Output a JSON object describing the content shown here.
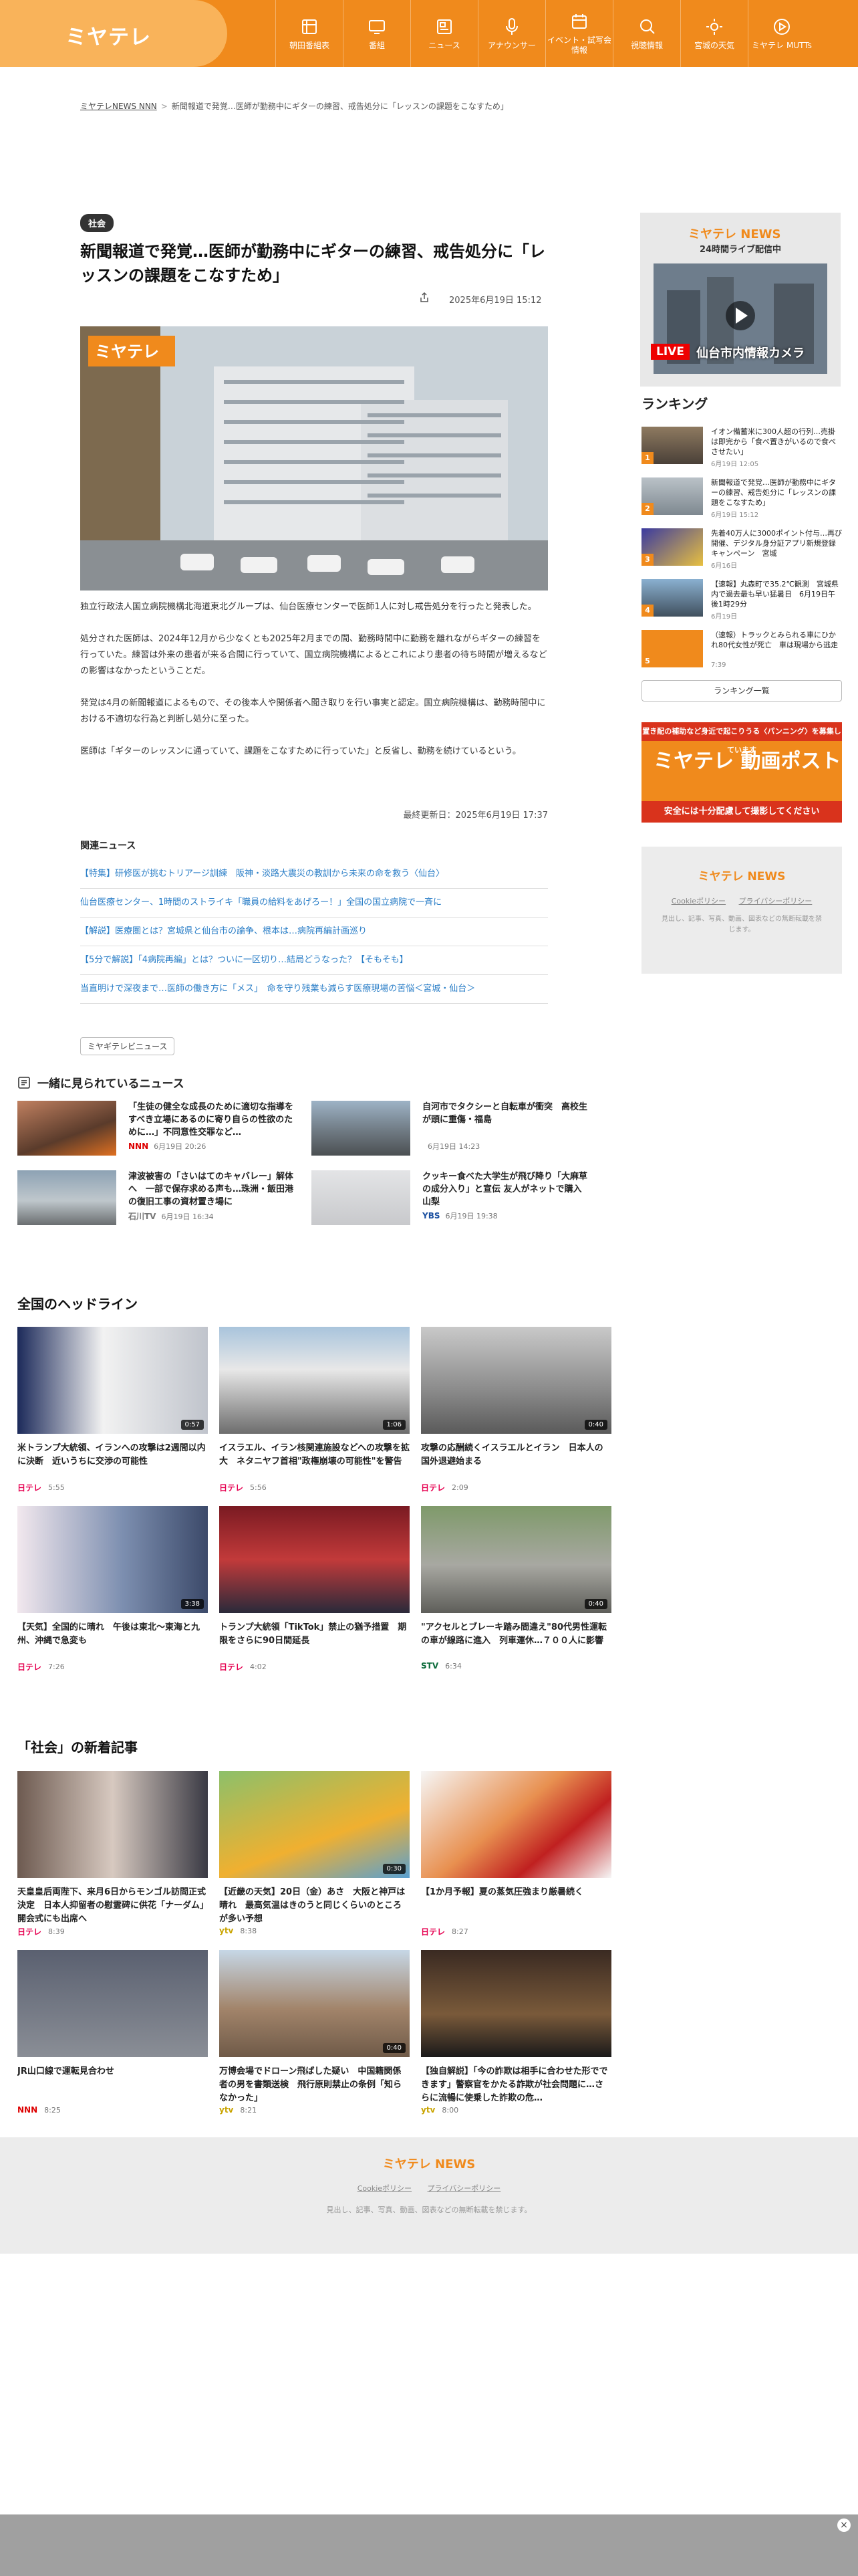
{
  "header": {
    "logo": "ミヤテレ",
    "nav": [
      {
        "label": "朝田番組表",
        "icon": "tv-guide-icon"
      },
      {
        "label": "番組",
        "icon": "monitor-icon"
      },
      {
        "label": "ニュース",
        "icon": "news-icon"
      },
      {
        "label": "アナウンサー",
        "icon": "microphone-icon"
      },
      {
        "label": "イベント・試写会情報",
        "icon": "calendar-icon"
      },
      {
        "label": "視聴情報",
        "icon": "person-search-icon"
      },
      {
        "label": "宮城の天気",
        "icon": "sun-icon"
      },
      {
        "label": "ミヤテレ MUTTs",
        "icon": "play-icon"
      }
    ]
  },
  "breadcrumb": {
    "home": "ミヤテレNEWS NNN",
    "sep": ">",
    "current": "新聞報道で発覚…医師が勤務中にギターの練習、戒告処分に「レッスンの課題をこなすため」"
  },
  "article": {
    "category": "社会",
    "title": "新聞報道で発覚…医師が勤務中にギターの練習、戒告処分に「レッスンの課題をこなすため」",
    "date": "2025年6月19日 15:12",
    "paragraphs": [
      "独立行政法人国立病院機構北海道東北グループは、仙台医療センターで医師1人に対し戒告処分を行ったと発表した。",
      "処分された医師は、2024年12月から少なくとも2025年2月までの間、勤務時間中に勤務を離れながらギターの練習を行っていた。練習は外来の患者が来る合間に行っていて、国立病院機構によるとこれにより患者の待ち時間が増えるなどの影響はなかったということだ。",
      "発覚は4月の新聞報道によるもので、その後本人や関係者へ聞き取りを行い事実と認定。国立病院機構は、勤務時間中における不適切な行為と判断し処分に至った。",
      "医師は「ギターのレッスンに通っていて、課題をこなすために行っていた」と反省し、勤務を続けているという。"
    ],
    "updated": "最終更新日：2025年6月19日 17:37",
    "related_heading": "関連ニュース",
    "related": [
      "【特集】研修医が挑むトリアージ訓練　阪神・淡路大震災の教訓から未来の命を救う〈仙台〉",
      "仙台医療センター、1時間のストライキ「職員の給料をあげろー！」全国の国立病院で一斉に",
      "【解説】医療圏とは？宮城県と仙台市の論争、根本は…病院再編計画巡り",
      "【5分で解説】「4病院再編」とは？ついに一区切り…結局どうなった？【そもそも】",
      "当直明けで深夜まで…医師の働き方に「メス」　命を守り残業も減らす医療現場の苦悩＜宮城・仙台＞"
    ],
    "source_tag": "ミヤギテレビニュース"
  },
  "together": {
    "heading": "一緒に見られているニュース",
    "items": [
      {
        "title": "「生徒の健全な成長のために適切な指導をすべき立場にあるのに寄り自らの性欲のために…」不同意性交罪など…",
        "station": "NNN",
        "date": "6月19日 20:26"
      },
      {
        "title": "自河市でタクシーと自転車が衝突　高校生が頭に重傷・福島",
        "station": "",
        "date": "6月19日 14:23"
      },
      {
        "title": "津波被害の「さいはてのキャバレー」解体へ　一部で保存求める声も…珠洲・飯田港の復旧工事の資材置き場に",
        "station": "石川TV",
        "date": "6月19日 16:34"
      },
      {
        "title": "クッキー食べた大学生が飛び降り「大麻草の成分入り」と宣伝 友人がネットで購入 山梨",
        "station": "YBS",
        "date": "6月19日 19:38"
      }
    ]
  },
  "headlines": {
    "heading": "全国のヘッドライン",
    "items": [
      {
        "title": "米トランプ大統領、イランへの攻撃は2週間以内に決断　近いうちに交渉の可能性",
        "station": "日テレ",
        "date": "5:55",
        "duration": "0:57"
      },
      {
        "title": "イスラエル、イラン核関連施設などへの攻撃を拡大　ネタニヤフ首相\"政権崩壊の可能性\"を警告",
        "station": "日テレ",
        "date": "5:56",
        "duration": "1:06"
      },
      {
        "title": "攻撃の応酬続くイスラエルとイラン　日本人の国外退避始まる",
        "station": "日テレ",
        "date": "2:09",
        "duration": "0:40"
      },
      {
        "title": "【天気】全国的に晴れ　午後は東北～東海と九州、沖縄で急変も",
        "station": "日テレ",
        "date": "7:26",
        "duration": "3:38"
      },
      {
        "title": "トランプ大統領「TikTok」禁止の猶予措置　期限をさらに90日間延長",
        "station": "日テレ",
        "date": "4:02",
        "duration": ""
      },
      {
        "title": "\"アクセルとブレーキ踏み間違え\"80代男性運転の車が線路に進入　列車運休…７００人に影響",
        "station": "STV",
        "date": "6:34",
        "duration": "0:40"
      }
    ]
  },
  "society": {
    "heading": "「社会」の新着記事",
    "items": [
      {
        "title": "天皇皇后両陛下、来月6日からモンゴル訪問正式決定　日本人抑留者の慰霊碑に供花「ナーダム」開会式にも出席へ",
        "station": "日テレ",
        "date": "8:39",
        "duration": ""
      },
      {
        "title": "【近畿の天気】20日（金）あさ　大阪と神戸は晴れ　最高気温はきのうと同じくらいのところが多い予想",
        "station": "ytv",
        "date": "8:38",
        "duration": "0:30"
      },
      {
        "title": "【1か月予報】夏の蒸気圧強まり厳暑続く",
        "station": "日テレ",
        "date": "8:27",
        "duration": ""
      },
      {
        "title": "JR山口線で運転見合わせ",
        "station": "NNN",
        "date": "8:25",
        "duration": ""
      },
      {
        "title": "万博会場でドローン飛ばした疑い　中国籍関係者の男を書類送検　飛行原則禁止の条例「知らなかった」",
        "station": "ytv",
        "date": "8:21",
        "duration": "0:40"
      },
      {
        "title": "【独自解説】「今の詐欺は相手に合わせた形でできます」警察官をかたる詐欺が社会問題に…さらに流暢に使乗した詐欺の危…",
        "station": "ytv",
        "date": "8:00",
        "duration": ""
      }
    ]
  },
  "sidebar": {
    "live_logo": "ミヤテレ NEWS",
    "live_sub": "24時間ライブ配信中",
    "live_badge": "LIVE",
    "live_caption": "仙台市内情報カメラ",
    "ranking_heading": "ランキング",
    "ranking": [
      {
        "no": "1",
        "title": "イオン備蓄米に300人超の行列…売掛は即完から「食べ置きがいるので食べさせたい」",
        "date": "6月19日 12:05"
      },
      {
        "no": "2",
        "title": "新聞報道で発覚…医師が勤務中にギターの練習、戒告処分に「レッスンの課題をこなすため」",
        "date": "6月19日 15:12"
      },
      {
        "no": "3",
        "title": "先着40万人に3000ポイント付与…再び開催、デジタル身分証アプリ新規登録キャンペーン　宮城",
        "date": "6月16日"
      },
      {
        "no": "4",
        "title": "【速報】丸森町で35.2℃観測　宮城県内で過去最も早い猛暑日　6月19日午後1時29分",
        "date": "6月19日"
      },
      {
        "no": "5",
        "title": "（速報）トラックとみられる車にひかれ80代女性が死亡　車は現場から逃走",
        "date": "7:39"
      }
    ],
    "ranking_more": "ランキング一覧",
    "ad_top": "置き配の補助など身近で起こりうる〈パンニング〉を募集しています",
    "ad_main": "ミヤテレ 動画ポスト",
    "ad_bottom": "安全には十分配慮して撮影してください",
    "foot_logo": "ミヤテレ NEWS",
    "foot_links": [
      "Cookieポリシー",
      "プライバシーポリシー"
    ],
    "foot_note": "見出し、記事、写真、動画、図表などの無断転載を禁じます。"
  },
  "footer": {
    "logo": "ミヤテレ NEWS",
    "links": [
      "Cookieポリシー",
      "プライバシーポリシー"
    ],
    "note": "見出し、記事、写真、動画、図表などの無断転載を禁じます。"
  },
  "colors": {
    "brand": "#f08a1c",
    "link": "#2a7ec7"
  }
}
